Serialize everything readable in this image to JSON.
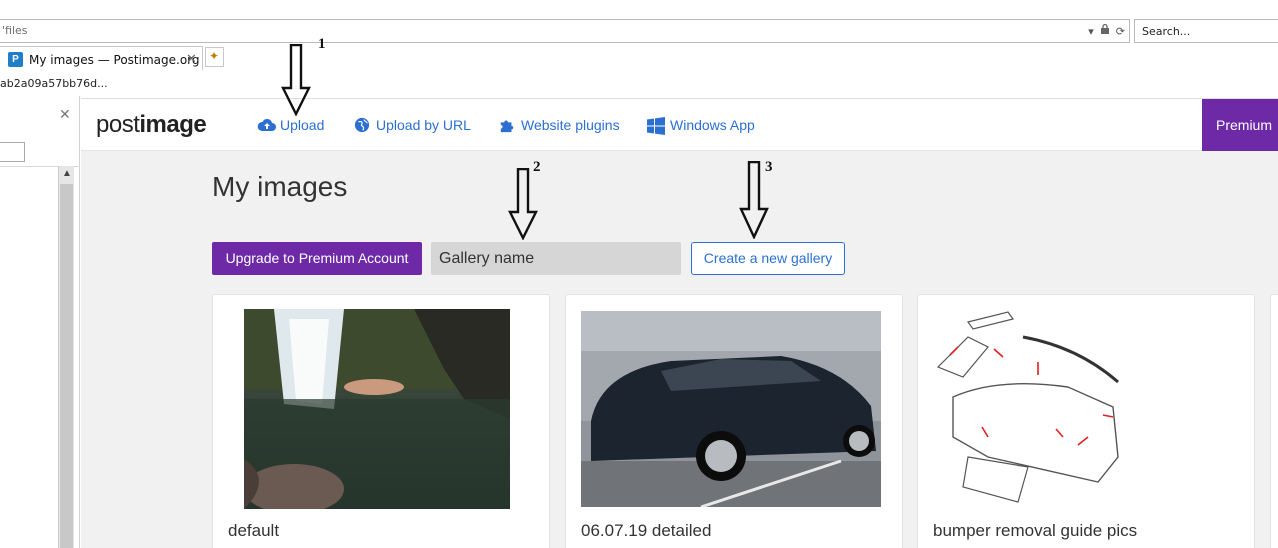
{
  "browser": {
    "url_fragment": "'files",
    "search_placeholder": "Search...",
    "tab_title": "My images — Postimage.org",
    "tab_favicon_letter": "P",
    "link_fragment": "ab2a09a57bb76d..."
  },
  "nav": {
    "logo_light": "post",
    "logo_bold": "image",
    "items": [
      {
        "label": "Upload",
        "icon": "cloud-upload-icon"
      },
      {
        "label": "Upload by URL",
        "icon": "globe-icon"
      },
      {
        "label": "Website plugins",
        "icon": "puzzle-icon"
      },
      {
        "label": "Windows App",
        "icon": "windows-icon"
      }
    ],
    "premium_label": "Premium"
  },
  "main": {
    "title": "My images",
    "upgrade_label": "Upgrade to Premium Account",
    "gallery_placeholder": "Gallery name",
    "create_label": "Create a new gallery"
  },
  "galleries": [
    {
      "name": "default"
    },
    {
      "name": "06.07.19 detailed"
    },
    {
      "name": "bumper removal guide pics"
    }
  ],
  "annotations": [
    "1",
    "2",
    "3"
  ],
  "colors": {
    "accent_blue": "#2b70d1",
    "premium_purple": "#6e2aa6"
  }
}
